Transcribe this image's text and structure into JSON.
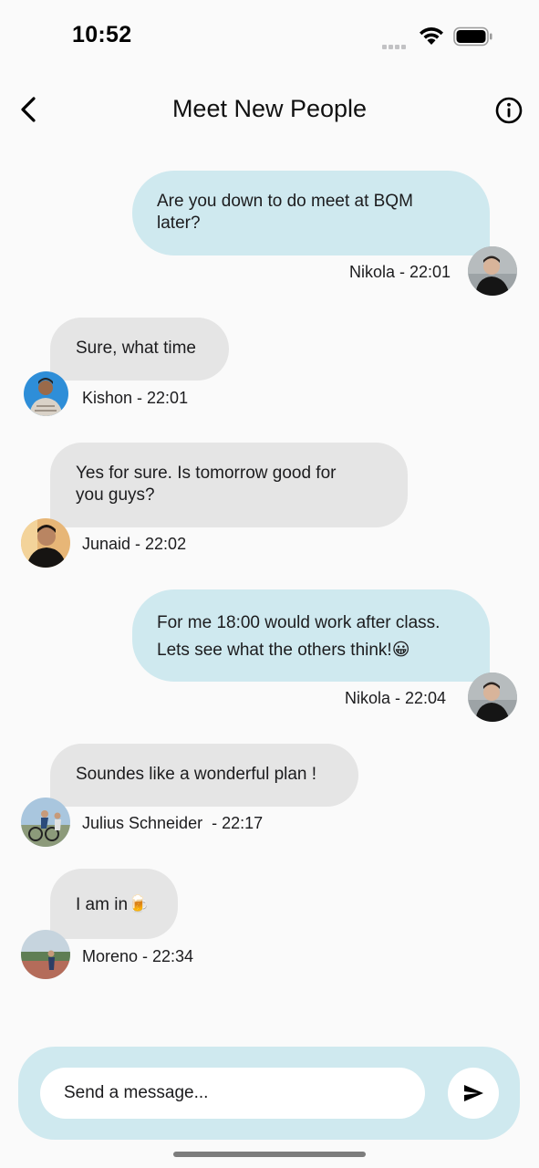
{
  "status_bar": {
    "time": "10:52"
  },
  "header": {
    "title": "Meet New People",
    "back_icon": "chevron-left-icon",
    "info_icon": "info-circle-icon"
  },
  "colors": {
    "outgoing_bubble": "#cfe9ef",
    "incoming_bubble": "#e5e5e5",
    "background": "#fafafa"
  },
  "messages": [
    {
      "direction": "outgoing",
      "lines": [
        "Are you down to do meet at BQM",
        "later?"
      ],
      "meta": "Nikola - 22:01"
    },
    {
      "direction": "incoming",
      "lines": [
        "Sure, what time"
      ],
      "meta": "Kishon - 22:01"
    },
    {
      "direction": "incoming",
      "lines": [
        "Yes for sure. Is tomorrow good for",
        "you guys?"
      ],
      "meta": "Junaid - 22:02"
    },
    {
      "direction": "outgoing",
      "lines": [
        "For me 18:00 would work after class.",
        "Lets see what the others think!😀"
      ],
      "meta": "Nikola - 22:04"
    },
    {
      "direction": "incoming",
      "lines": [
        "Soundes like a wonderful plan !"
      ],
      "meta": "Julius Schneider  - 22:17"
    },
    {
      "direction": "incoming",
      "lines": [
        "I am in🍺"
      ],
      "meta": "Moreno - 22:34"
    }
  ],
  "composer": {
    "placeholder": "Send a message...",
    "value": "",
    "send_icon": "send-icon"
  }
}
